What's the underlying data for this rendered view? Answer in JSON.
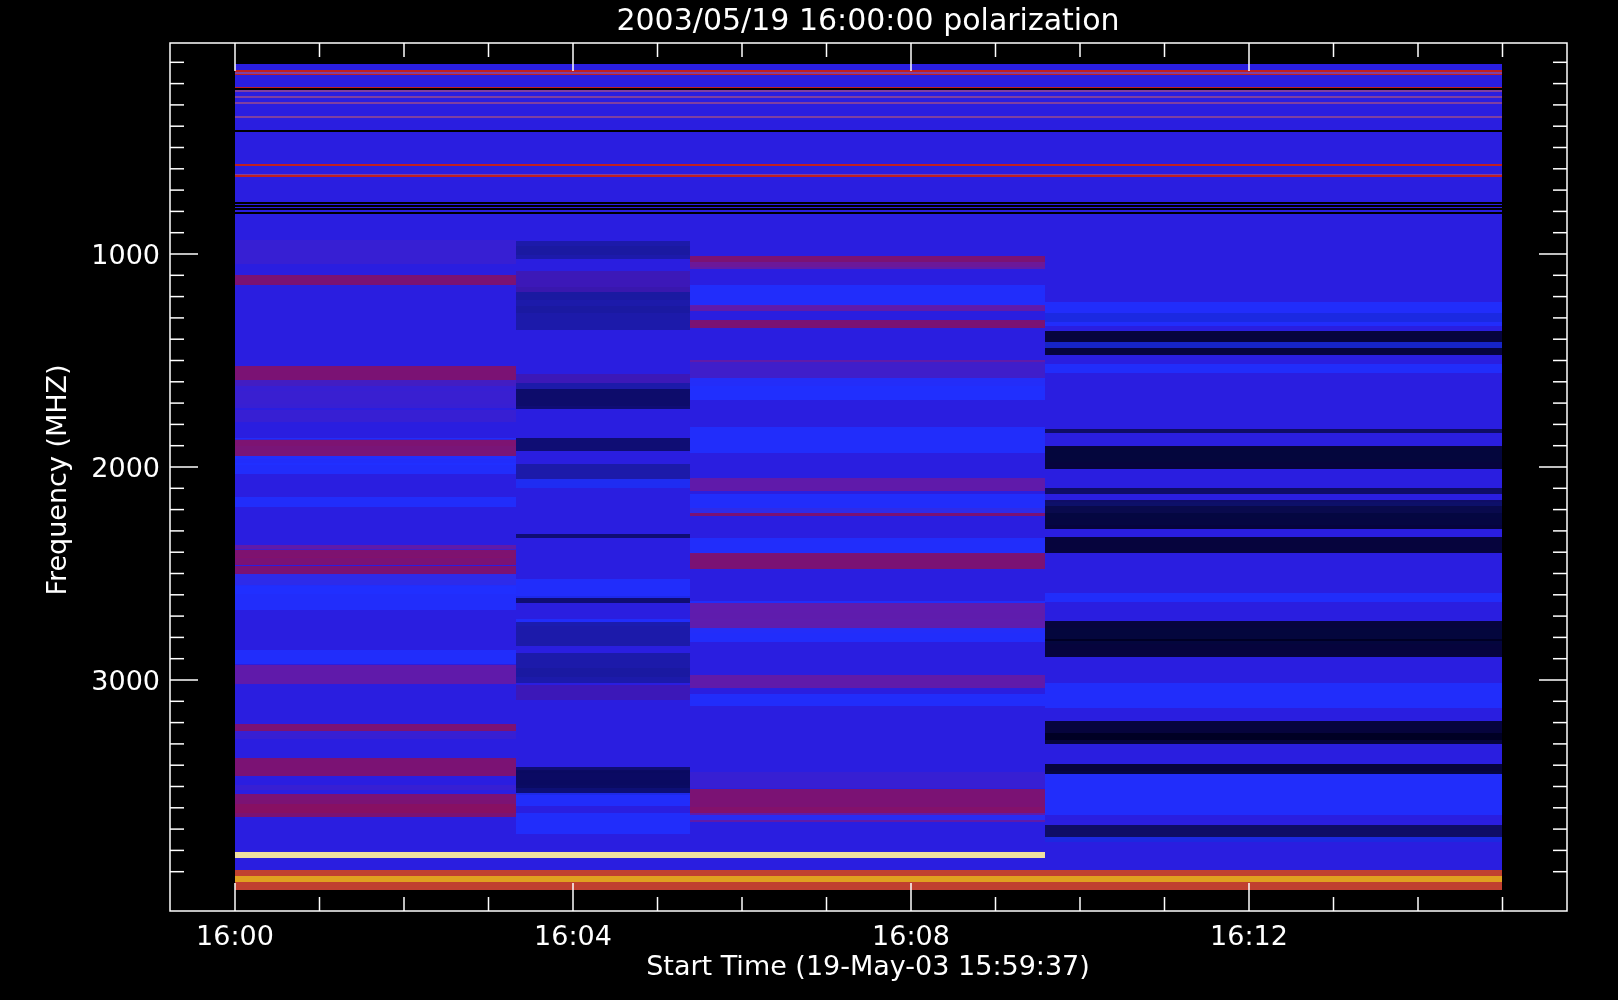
{
  "plot": {
    "title": "2003/05/19 16:00:00 polarization",
    "x_axis": {
      "label": "Start Time (19-May-03 15:59:37)",
      "ticks": [
        "16:00",
        "16:04",
        "16:08",
        "16:12"
      ]
    },
    "y_axis": {
      "label": "Frequency (MHZ)",
      "ticks": [
        "1000",
        "2000",
        "3000"
      ]
    }
  }
}
